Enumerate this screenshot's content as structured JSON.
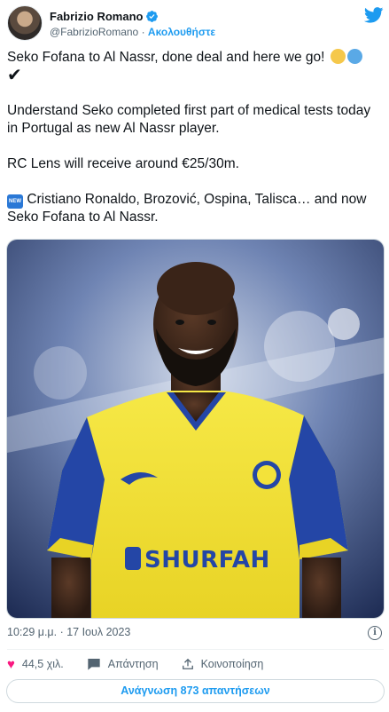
{
  "author": {
    "name": "Fabrizio Romano",
    "handle": "@FabrizioRomano",
    "separator": "·",
    "follow_label": "Ακολουθήστε"
  },
  "tweet": {
    "line1": "Seko Fofana to Al Nassr, done deal and here we go!",
    "check": "✔",
    "para2": "Understand Seko completed first part of medical tests today in Portugal as new Al Nassr player.",
    "para3": "RC Lens will receive around €25/30m.",
    "new_badge": "NEW",
    "para4": "Cristiano Ronaldo, Brozović, Ospina, Talisca… and now Seko Fofana to Al Nassr.",
    "emoji_colors": [
      "#f5c84b",
      "#5aa9e6"
    ]
  },
  "photo": {
    "shirt_sponsor": "SHURFAH",
    "colors": {
      "shirt": "#f3e23a",
      "sleeve": "#2446a6",
      "bg_top": "#2c3f70",
      "bg_light": "#cfd8e8"
    }
  },
  "meta": {
    "timestamp": "10:29 μ.μ. · 17 Ιουλ 2023",
    "info_icon": "i"
  },
  "actions": {
    "likes": "44,5 χιλ.",
    "reply_label": "Απάντηση",
    "share_label": "Κοινοποίηση"
  },
  "read_replies": "Ανάγνωση 873 απαντήσεων",
  "colors": {
    "accent": "#1d9bf0",
    "like": "#f91880",
    "muted": "#536471"
  }
}
